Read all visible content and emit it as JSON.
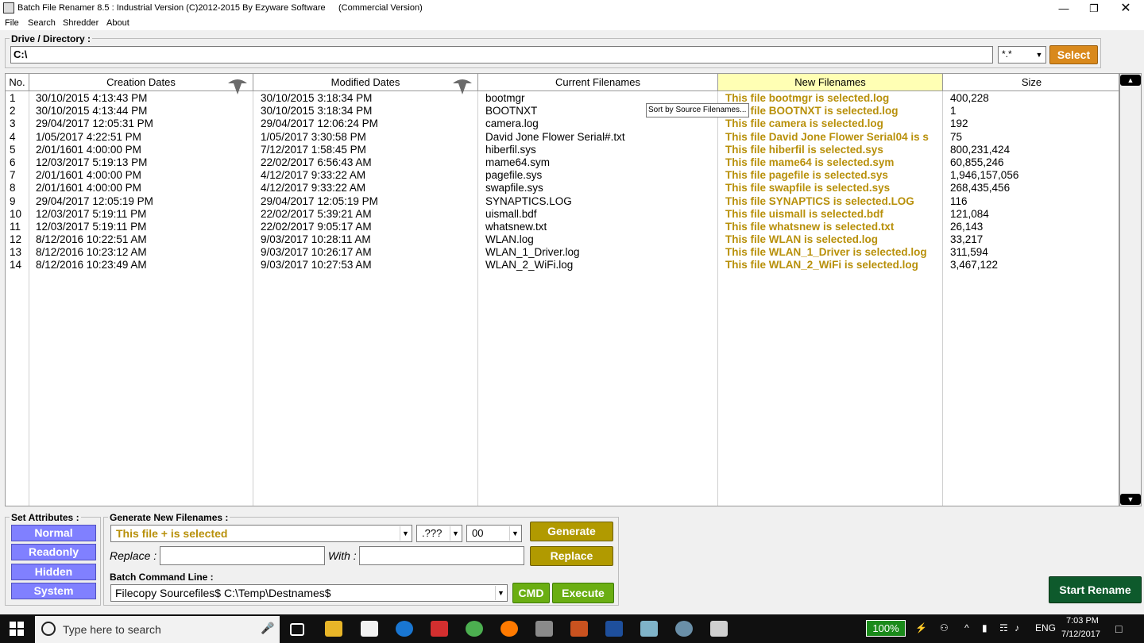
{
  "window": {
    "title": "Batch File Renamer 8.5 : Industrial Version (C)2012-2015 By Ezyware Software",
    "subtitle": "(Commercial Version)"
  },
  "menu": [
    "File",
    "Search",
    "Shredder",
    "About"
  ],
  "drive": {
    "label": "Drive / Directory :",
    "value": "C:\\",
    "mask": "*.*",
    "select_label": "Select"
  },
  "table": {
    "headers": [
      "No.",
      "Creation Dates",
      "Modified Dates",
      "Current Filenames",
      "New Filenames",
      "Size"
    ],
    "rows": [
      [
        "1",
        "30/10/2015 4:13:43 PM",
        "30/10/2015 3:18:34 PM",
        "bootmgr",
        "This file bootmgr is selected.log",
        "400,228"
      ],
      [
        "2",
        "30/10/2015 4:13:44 PM",
        "30/10/2015 3:18:34 PM",
        "BOOTNXT",
        "This file BOOTNXT is selected.log",
        "1"
      ],
      [
        "3",
        "29/04/2017 12:05:31 PM",
        "29/04/2017 12:06:24 PM",
        "camera.log",
        "This file camera is selected.log",
        "192"
      ],
      [
        "4",
        "1/05/2017 4:22:51 PM",
        "1/05/2017 3:30:58 PM",
        "David Jone Flower Serial#.txt",
        "This file David Jone Flower Serial04 is s",
        "75"
      ],
      [
        "5",
        "2/01/1601 4:00:00 PM",
        "7/12/2017 1:58:45 PM",
        "hiberfil.sys",
        "This file hiberfil is selected.sys",
        "800,231,424"
      ],
      [
        "6",
        "12/03/2017 5:19:13 PM",
        "22/02/2017 6:56:43 AM",
        "mame64.sym",
        "This file mame64 is selected.sym",
        "60,855,246"
      ],
      [
        "7",
        "2/01/1601 4:00:00 PM",
        "4/12/2017 9:33:22 AM",
        "pagefile.sys",
        "This file pagefile is selected.sys",
        "1,946,157,056"
      ],
      [
        "8",
        "2/01/1601 4:00:00 PM",
        "4/12/2017 9:33:22 AM",
        "swapfile.sys",
        "This file swapfile is selected.sys",
        "268,435,456"
      ],
      [
        "9",
        "29/04/2017 12:05:19 PM",
        "29/04/2017 12:05:19 PM",
        "SYNAPTICS.LOG",
        "This file SYNAPTICS is selected.LOG",
        "116"
      ],
      [
        "10",
        "12/03/2017 5:19:11 PM",
        "22/02/2017 5:39:21 AM",
        "uismall.bdf",
        "This file uismall is selected.bdf",
        "121,084"
      ],
      [
        "11",
        "12/03/2017 5:19:11 PM",
        "22/02/2017 9:05:17 AM",
        "whatsnew.txt",
        "This file whatsnew is selected.txt",
        "26,143"
      ],
      [
        "12",
        "8/12/2016 10:22:51 AM",
        "9/03/2017 10:28:11 AM",
        "WLAN.log",
        "This file WLAN is selected.log",
        "33,217"
      ],
      [
        "13",
        "8/12/2016 10:23:12 AM",
        "9/03/2017 10:26:17 AM",
        "WLAN_1_Driver.log",
        "This file WLAN_1_Driver is selected.log",
        "311,594"
      ],
      [
        "14",
        "8/12/2016 10:23:49 AM",
        "9/03/2017 10:27:53 AM",
        "WLAN_2_WiFi.log",
        "This file WLAN_2_WiFi is selected.log",
        "3,467,122"
      ]
    ],
    "tooltip": "Sort by Source Filenames..."
  },
  "attributes": {
    "label": "Set Attributes :",
    "buttons": [
      "Normal",
      "Readonly",
      "Hidden",
      "System"
    ]
  },
  "generate": {
    "label": "Generate New Filenames  :",
    "pattern": "This file + is selected",
    "ext": ".???",
    "num": "00",
    "generate_label": "Generate",
    "replace_btn_label": "Replace",
    "replace_label": "Replace :",
    "with_label": "With :"
  },
  "batch": {
    "label": "Batch Command Line :",
    "value": "Filecopy Sourcefiles$ C:\\Temp\\Destnames$",
    "cmd_label": "CMD",
    "execute_label": "Execute"
  },
  "start_rename": "Start Rename",
  "taskbar": {
    "search_placeholder": "Type here to search",
    "battery": "100%",
    "language": "ENG",
    "time": "7:03 PM",
    "date": "7/12/2017"
  },
  "colors": {
    "new_filename_text": "#b8900a",
    "select_button": "#d9891c",
    "attribute_button": "#8080ff",
    "generate_button": "#b19a00",
    "execute_button": "#6aae12",
    "start_rename_button": "#0e5a2c"
  }
}
